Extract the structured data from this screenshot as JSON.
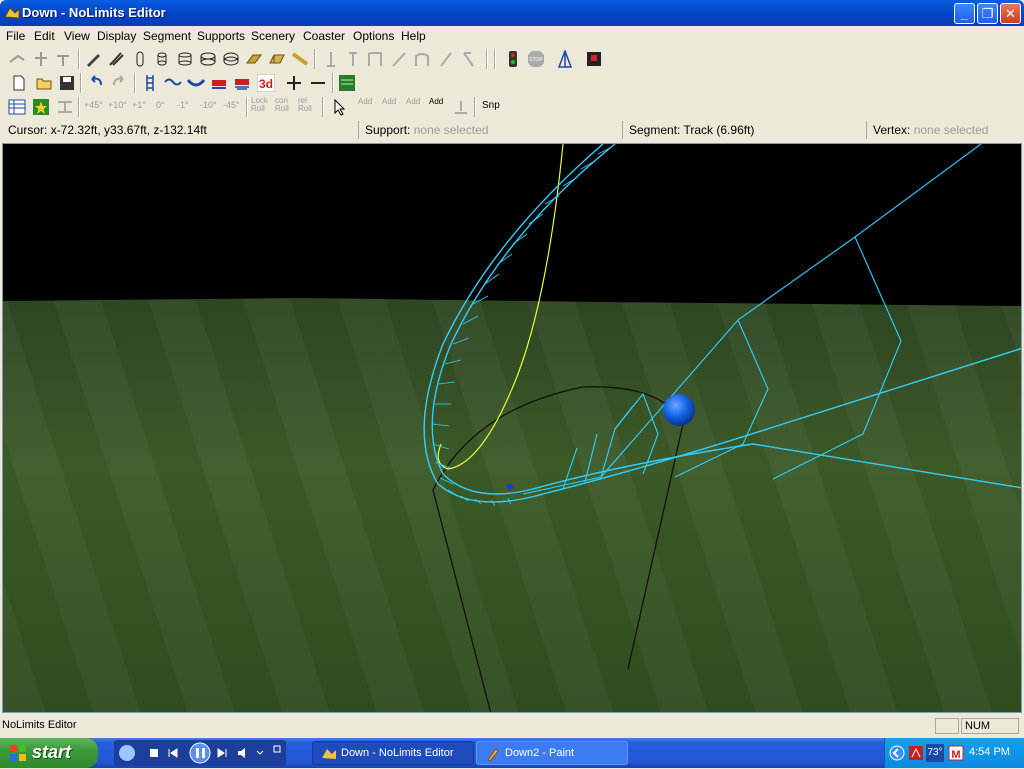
{
  "window": {
    "title": "Down - NoLimits Editor"
  },
  "menu": [
    "File",
    "Edit",
    "View",
    "Display",
    "Segment",
    "Supports",
    "Scenery",
    "Coaster",
    "Options",
    "Help"
  ],
  "toolbar3": {
    "angles": [
      "+45°",
      "+10°",
      "+1°",
      "0°",
      "-1°",
      "-10°",
      "-45°"
    ],
    "lock_roll": "Lock Roll",
    "con_roll": "con Roll",
    "rel_roll": "rel Roll",
    "add_labels": [
      "Add",
      "Add",
      "Add",
      "Add"
    ],
    "snap": "Snp"
  },
  "status": {
    "cursor_label": "Cursor:",
    "cursor_value": "x-72.32ft, y33.67ft, z-132.14ft",
    "support_label": "Support:",
    "support_value": "none selected",
    "segment_label": "Segment:",
    "segment_value": "Track (6.96ft)",
    "vertex_label": "Vertex:",
    "vertex_value": "none selected"
  },
  "bottom_status": {
    "text": "NoLimits Editor",
    "num": "NUM"
  },
  "taskbar": {
    "start": "start",
    "tasks": [
      {
        "label": "Down - NoLimits Editor",
        "active": true
      },
      {
        "label": "Down2 - Paint",
        "active": false
      }
    ],
    "temperature": "73°",
    "clock": "4:54 PM"
  },
  "colors": {
    "track": "#2fd0ff",
    "spline": "#e6ff3a",
    "ground": "#3e5a28",
    "sky": "#000000",
    "handle_ball": "#1565e8"
  }
}
